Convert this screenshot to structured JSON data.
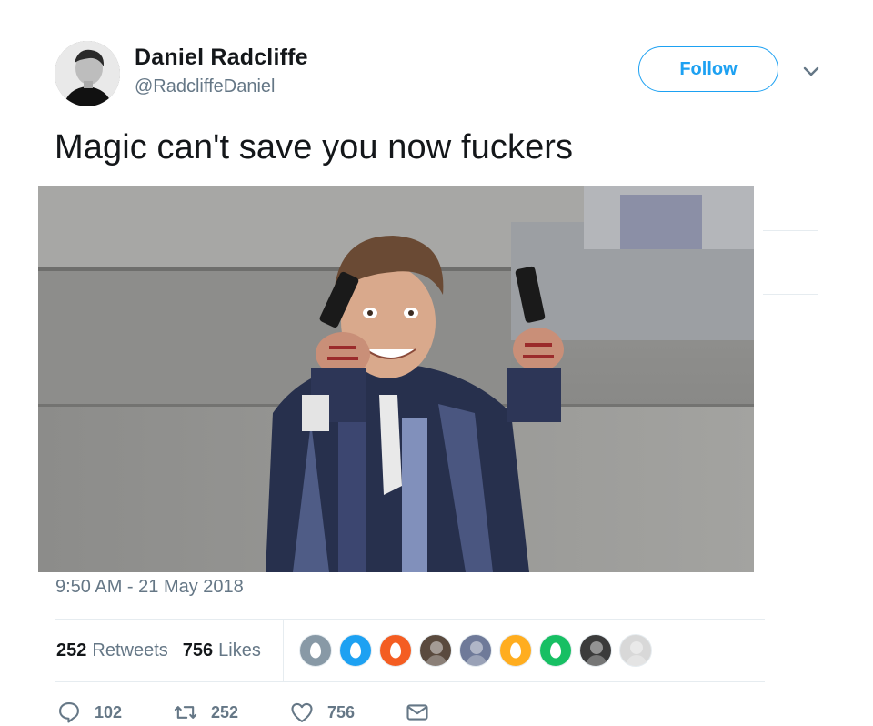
{
  "user": {
    "name": "Daniel Radcliffe",
    "handle": "@RadcliffeDaniel",
    "follow_label": "Follow"
  },
  "tweet": {
    "text": "Magic can't save you now fuckers",
    "timestamp": "9:50 AM - 21 May 2018"
  },
  "stats": {
    "retweets_count": "252",
    "retweets_label": "Retweets",
    "likes_count": "756",
    "likes_label": "Likes"
  },
  "likers": [
    {
      "kind": "egg",
      "color": "#8899a6"
    },
    {
      "kind": "egg",
      "color": "#1da1f2"
    },
    {
      "kind": "egg",
      "color": "#f45d22"
    },
    {
      "kind": "photo",
      "color": "#5a4a3e"
    },
    {
      "kind": "photo",
      "color": "#6f7a99"
    },
    {
      "kind": "egg",
      "color": "#ffad1f"
    },
    {
      "kind": "egg",
      "color": "#17bf63"
    },
    {
      "kind": "photo",
      "color": "#3b3b3b"
    },
    {
      "kind": "photo",
      "color": "#d8d8d8"
    }
  ],
  "actions": {
    "reply_count": "102",
    "retweet_count": "252",
    "like_count": "756"
  },
  "icons": [
    "chevron-down-icon",
    "reply-icon",
    "retweet-icon",
    "heart-icon",
    "envelope-icon"
  ],
  "colors": {
    "accent": "#1da1f2",
    "secondary_text": "#657786",
    "divider": "#e6ecf0"
  }
}
